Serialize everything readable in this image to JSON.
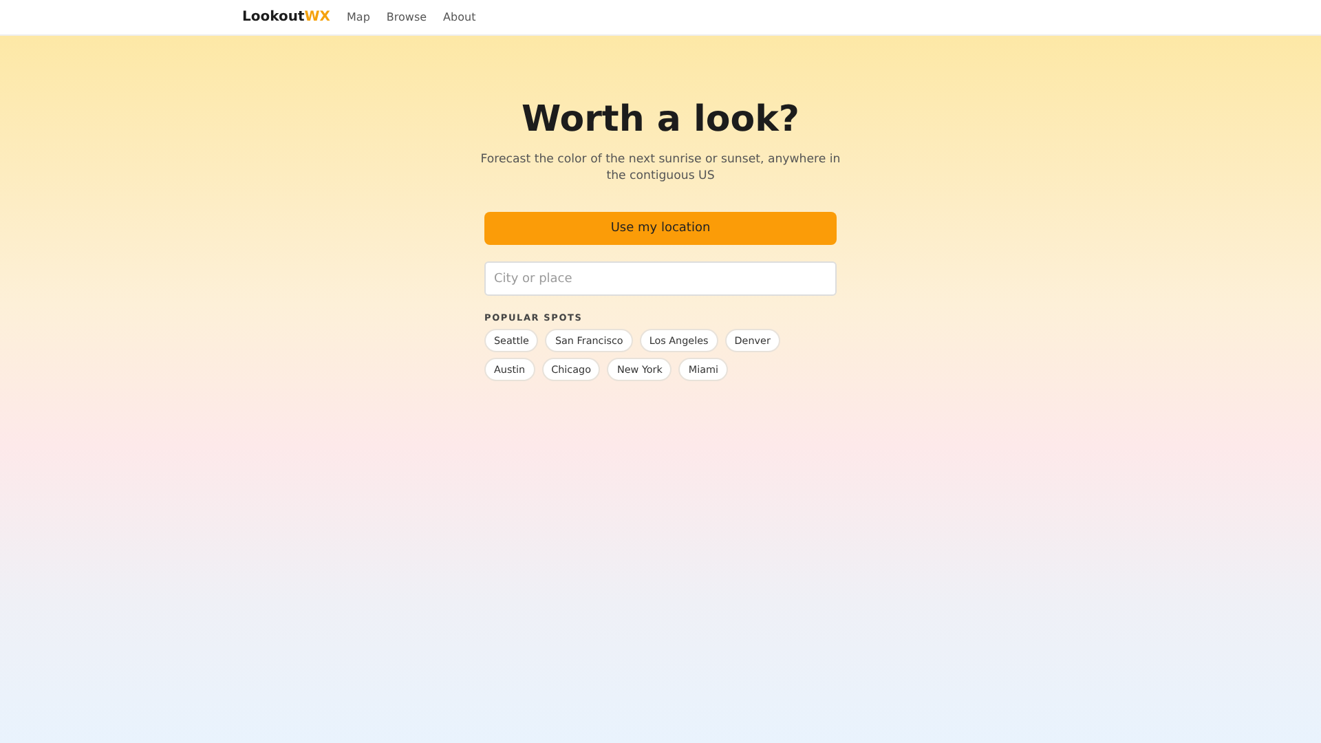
{
  "nav": {
    "logo": {
      "main": "Lookout",
      "accent": "WX"
    },
    "links": [
      "Map",
      "Browse",
      "About"
    ]
  },
  "hero": {
    "title": "Worth a look?",
    "subtitle": "Forecast the color of the next sunrise or sunset, anywhere in the contiguous US"
  },
  "location_button": "Use my location",
  "search": {
    "placeholder": "City or place"
  },
  "popular": {
    "heading": "POPULAR SPOTS",
    "spots": [
      "Seattle",
      "San Francisco",
      "Los Angeles",
      "Denver",
      "Austin",
      "Chicago",
      "New York",
      "Miami"
    ]
  }
}
